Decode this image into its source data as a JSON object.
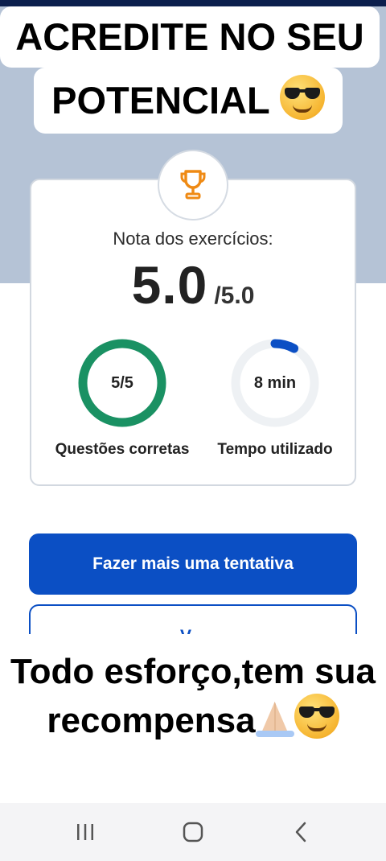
{
  "overlay": {
    "top_caption_line1": "ACREDITE NO SEU",
    "top_caption_line2": "POTENCIAL",
    "top_caption_emoji": "smiling-face-with-sunglasses",
    "bottom_caption_line1": "Todo esforço,tem sua",
    "bottom_caption_line2": "recompensa",
    "bottom_caption_emojis": [
      "folded-hands",
      "smiling-face-with-sunglasses"
    ]
  },
  "result_card": {
    "icon": "trophy-icon",
    "label": "Nota dos exercícios:",
    "score": "5.0",
    "max_score": "/5.0",
    "correct": {
      "value_text": "5/5",
      "label": "Questões corretas",
      "progress": 1.0
    },
    "time": {
      "value_text": "8 min",
      "label": "Tempo utilizado",
      "progress": 0.08
    }
  },
  "actions": {
    "retry_label": "Fazer mais uma tentativa",
    "second_label": "V        ~"
  },
  "colors": {
    "primary": "#0b4fc4",
    "success_ring": "#1a9163",
    "trophy": "#ef8a14",
    "band": "#b5c3d6"
  },
  "navigation": [
    "recent-apps-icon",
    "home-icon",
    "back-icon"
  ]
}
